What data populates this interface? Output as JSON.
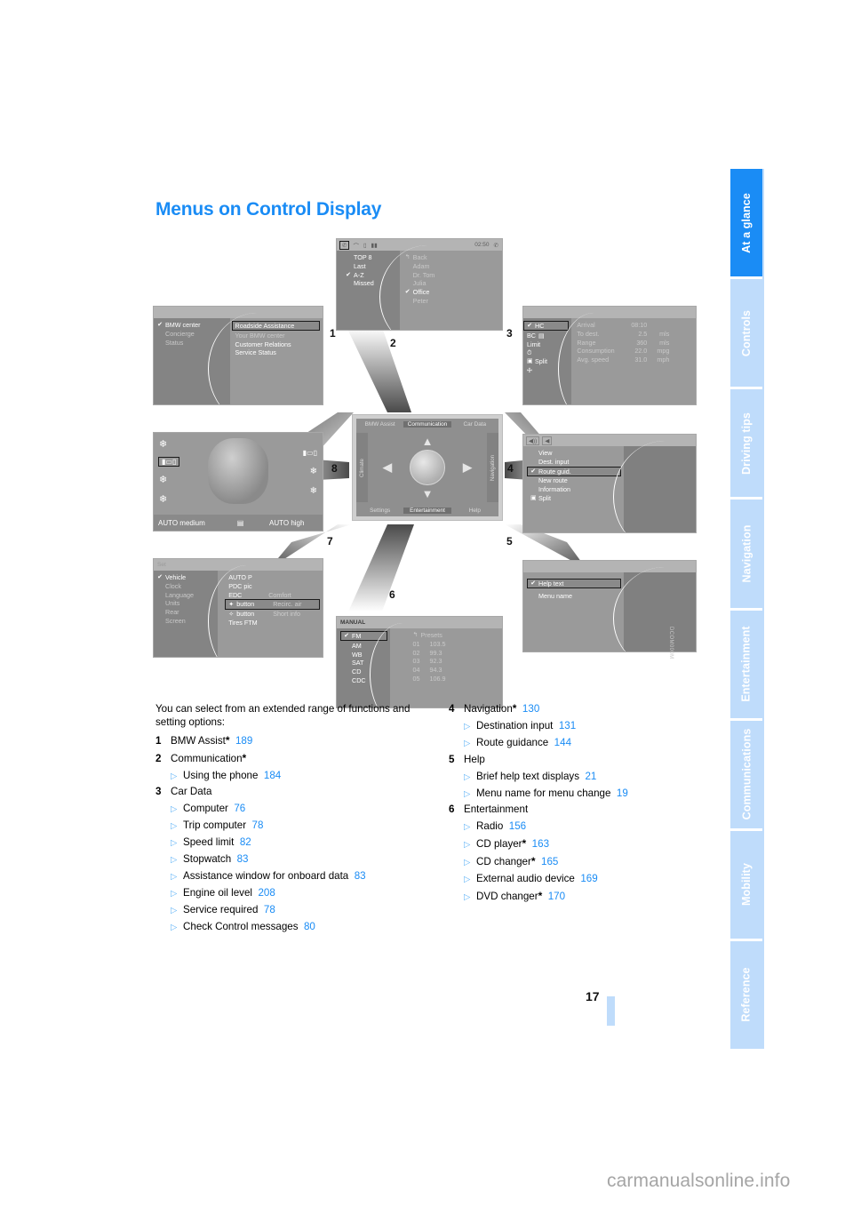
{
  "page_title": "Menus on Control Display",
  "page_number": "17",
  "watermark": "carmanualsonline.info",
  "figure_code": "DCOM000M",
  "sidebar": {
    "tabs": [
      {
        "label": "At a glance",
        "active": true
      },
      {
        "label": "Controls",
        "active": false
      },
      {
        "label": "Driving tips",
        "active": false
      },
      {
        "label": "Navigation",
        "active": false
      },
      {
        "label": "Entertainment",
        "active": false
      },
      {
        "label": "Communications",
        "active": false
      },
      {
        "label": "Mobility",
        "active": false
      },
      {
        "label": "Reference",
        "active": false
      }
    ]
  },
  "intro": "You can select from an extended range of functions and setting options:",
  "items_left": [
    {
      "num": "1",
      "label": "BMW Assist",
      "star": true,
      "page": "189",
      "subs": []
    },
    {
      "num": "2",
      "label": "Communication",
      "star": true,
      "page": "",
      "subs": [
        {
          "label": "Using the phone",
          "page": "184"
        }
      ]
    },
    {
      "num": "3",
      "label": "Car Data",
      "star": false,
      "page": "",
      "subs": [
        {
          "label": "Computer",
          "page": "76"
        },
        {
          "label": "Trip computer",
          "page": "78"
        },
        {
          "label": "Speed limit",
          "page": "82"
        },
        {
          "label": "Stopwatch",
          "page": "83"
        },
        {
          "label": "Assistance window for onboard data",
          "page": "83"
        },
        {
          "label": "Engine oil level",
          "page": "208"
        },
        {
          "label": "Service required",
          "page": "78"
        },
        {
          "label": "Check Control messages",
          "page": "80"
        }
      ]
    }
  ],
  "items_right": [
    {
      "num": "4",
      "label": "Navigation",
      "star": true,
      "page": "130",
      "subs": [
        {
          "label": "Destination input",
          "page": "131"
        },
        {
          "label": "Route guidance",
          "page": "144"
        }
      ]
    },
    {
      "num": "5",
      "label": "Help",
      "star": false,
      "page": "",
      "subs": [
        {
          "label": "Brief help text displays",
          "page": "21"
        },
        {
          "label": "Menu name for menu change",
          "page": "19"
        }
      ]
    },
    {
      "num": "6",
      "label": "Entertainment",
      "star": false,
      "page": "",
      "subs": [
        {
          "label": "Radio",
          "page": "156"
        },
        {
          "label": "CD player",
          "star": true,
          "page": "163"
        },
        {
          "label": "CD changer",
          "star": true,
          "page": "165"
        },
        {
          "label": "External audio device",
          "page": "169"
        },
        {
          "label": "DVD changer",
          "star": true,
          "page": "170"
        }
      ]
    }
  ],
  "figure": {
    "callouts": [
      "1",
      "2",
      "3",
      "4",
      "5",
      "6",
      "7",
      "8"
    ],
    "hub": {
      "top": [
        "BMW Assist",
        "Communication",
        "Car Data"
      ],
      "bottom": [
        "Settings",
        "Entertainment",
        "Help"
      ],
      "left": "Climate",
      "right": "Navigation",
      "selected_top": "Communication",
      "selected_bottom": "Entertainment"
    },
    "screen1_bmw_assist": {
      "left": [
        "BMW center",
        "Concierge",
        "Status"
      ],
      "left_checked": "BMW center",
      "right": [
        "Roadside Assistance",
        "Your BMW center",
        "Customer Relations",
        "Service Status"
      ],
      "right_highlighted": "Roadside Assistance"
    },
    "screen2_communication": {
      "status_time": "02:50",
      "left": [
        "TOP 8",
        "Last",
        "A-Z",
        "Missed"
      ],
      "left_checked": "A-Z",
      "right": [
        "Back",
        "Adam",
        "Dr. Tom",
        "Julia",
        "Office",
        "Peter"
      ],
      "right_checked": "Office"
    },
    "screen3_car_data": {
      "left": [
        "HC",
        "BC",
        "Limit",
        "Split"
      ],
      "left_checked": "HC",
      "rows": [
        {
          "label": "Arrival",
          "value": "08:10",
          "unit": ""
        },
        {
          "label": "To dest.",
          "value": "2.5",
          "unit": "mls"
        },
        {
          "label": "Range",
          "value": "360",
          "unit": "mls"
        },
        {
          "label": "Consumption",
          "value": "22.0",
          "unit": "mpg"
        },
        {
          "label": "Avg. speed",
          "value": "31.0",
          "unit": "mph"
        }
      ]
    },
    "screen4_navigation": {
      "items": [
        "View",
        "Dest. input",
        "Route guid.",
        "New route",
        "Information",
        "Split"
      ],
      "checked": "Route guid."
    },
    "screen5_help": {
      "items": [
        "Help text",
        "Menu name"
      ],
      "checked": "Help text"
    },
    "screen6_entertainment": {
      "mode": "MANUAL",
      "left": [
        "FM",
        "AM",
        "WB",
        "SAT",
        "CD",
        "CDC"
      ],
      "left_checked": "FM",
      "presets_label": "Presets",
      "presets": [
        {
          "no": "01",
          "freq": "103.5"
        },
        {
          "no": "02",
          "freq": "99.3"
        },
        {
          "no": "03",
          "freq": "92.3"
        },
        {
          "no": "04",
          "freq": "94.3"
        },
        {
          "no": "05",
          "freq": "106.9"
        }
      ]
    },
    "screen7_settings": {
      "title": "Set",
      "left": [
        "Vehicle",
        "Clock",
        "Language",
        "Units",
        "Rear",
        "Screen"
      ],
      "left_checked": "Vehicle",
      "right": [
        {
          "label": "AUTO P",
          "value": ""
        },
        {
          "label": "PDC pic",
          "value": ""
        },
        {
          "label": "EDC",
          "value": "Comfort"
        },
        {
          "label": "button",
          "value": "Recirc. air"
        },
        {
          "label": "button",
          "value": "Short info"
        },
        {
          "label": "Tires FTM",
          "value": ""
        }
      ],
      "highlighted": "button"
    },
    "screen8_climate": {
      "auto_left": "AUTO medium",
      "auto_right": "AUTO high"
    }
  }
}
